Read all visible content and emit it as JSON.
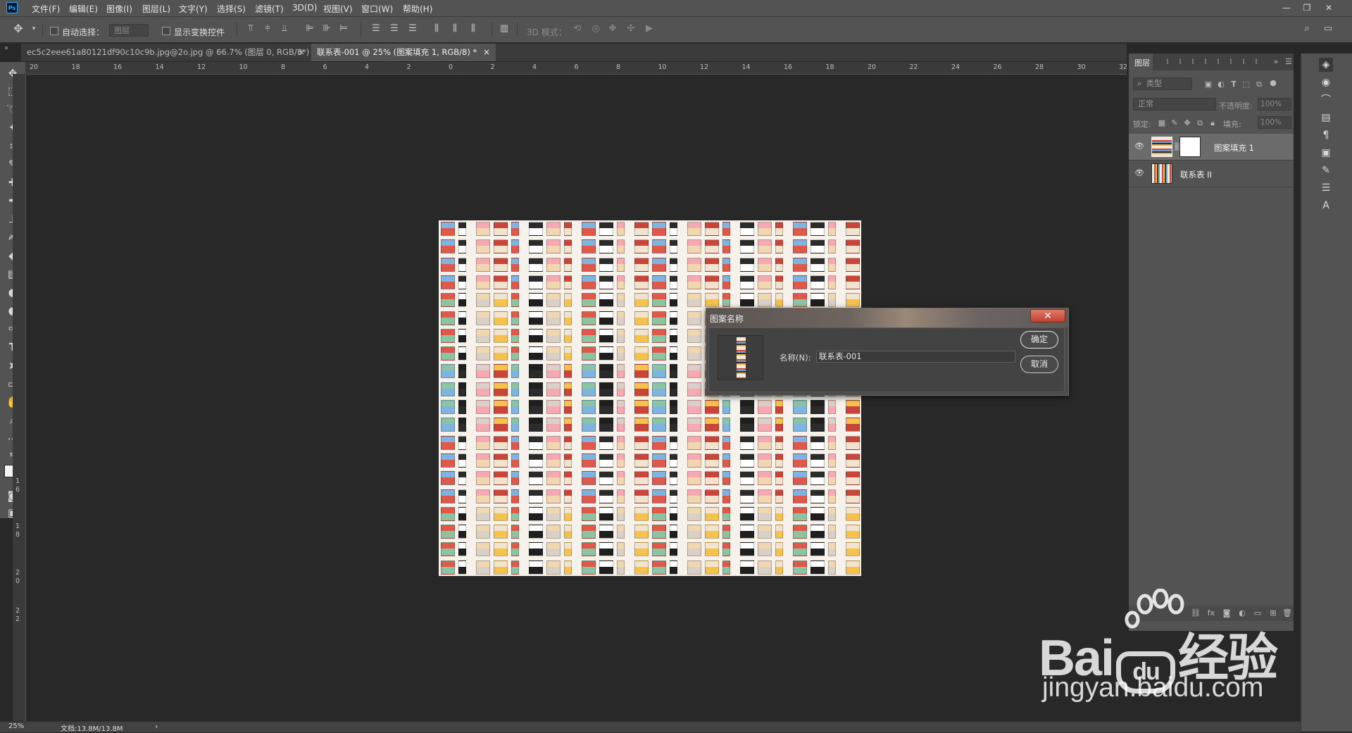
{
  "app": {
    "logo": "Ps"
  },
  "menu": [
    "文件(F)",
    "编辑(E)",
    "图像(I)",
    "图层(L)",
    "文字(Y)",
    "选择(S)",
    "滤镜(T)",
    "3D(D)",
    "视图(V)",
    "窗口(W)",
    "帮助(H)"
  ],
  "options": {
    "auto_select_label": "自动选择：",
    "auto_select_value": "图层",
    "show_transform_label": "显示变换控件",
    "mode_3d_label": "3D 模式："
  },
  "tabs": [
    {
      "label": "ec5c2eee61a80121df90c10c9b.jpg@2o.jpg @ 66.7% (图层 0, RGB/8*) *",
      "active": false
    },
    {
      "label": "联系表-001 @ 25% (图案填充 1, RGB/8) *",
      "active": true
    }
  ],
  "ruler": {
    "h_ticks": [
      "20",
      "18",
      "16",
      "14",
      "12",
      "10",
      "8",
      "6",
      "4",
      "2",
      "0",
      "2",
      "4",
      "6",
      "8",
      "10",
      "12",
      "14",
      "16",
      "18",
      "20",
      "22",
      "24",
      "26",
      "28",
      "30",
      "32"
    ],
    "v_ticks": [
      "1",
      "6",
      "1",
      "8",
      "2",
      "0",
      "2",
      "2"
    ]
  },
  "dialog": {
    "title": "图案名称",
    "name_label": "名称(N):",
    "name_value": "联系表-001",
    "ok_label": "确定",
    "cancel_label": "取消",
    "close_glyph": "✕"
  },
  "layers_panel": {
    "tab_label": "图层",
    "search_placeholder": "类型",
    "blend_mode": "正常",
    "opacity_label": "不透明度:",
    "opacity_value": "100%",
    "lock_label": "锁定:",
    "fill_label": "填充:",
    "fill_value": "100%",
    "layers": [
      {
        "name": "图案填充 1",
        "selected": true
      },
      {
        "name": "联系表 II",
        "selected": false
      }
    ]
  },
  "status": {
    "zoom": "25%",
    "doc_info": "文档:13.8M/13.8M"
  },
  "watermark": {
    "brand": "Bai",
    "brand_suffix": "经验",
    "url": "jingyan.baidu.com"
  },
  "colors": {
    "accent": "#31a8ff",
    "close_red": "#c0402e",
    "panel": "#535353",
    "canvas": "#282828"
  }
}
